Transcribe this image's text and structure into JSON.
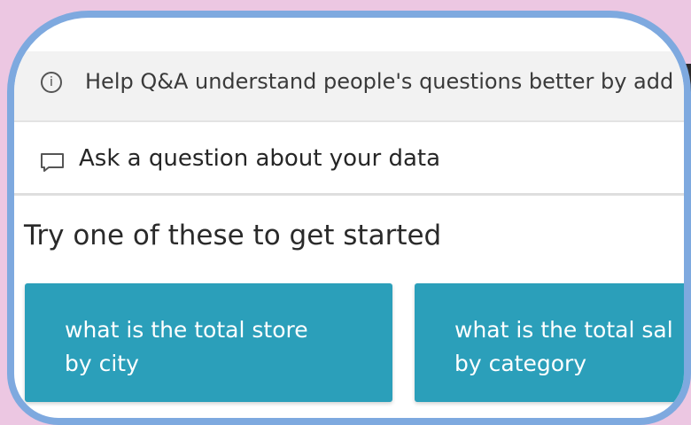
{
  "info_bar": {
    "icon": "info-icon",
    "icon_glyph": "i",
    "text": "Help Q&A understand people's questions better by add"
  },
  "ask": {
    "icon": "chat-icon",
    "text": "Ask a question about your data"
  },
  "suggestions": {
    "heading": "Try one of these to get started",
    "items": [
      {
        "line1": "what is the total store",
        "line2": "by city"
      },
      {
        "line1": "what is the total sal",
        "line2": "by category"
      }
    ]
  },
  "colors": {
    "page_background": "#ecc7e2",
    "frame_border": "#7ea9df",
    "suggestion_tile": "#2b9fba"
  }
}
